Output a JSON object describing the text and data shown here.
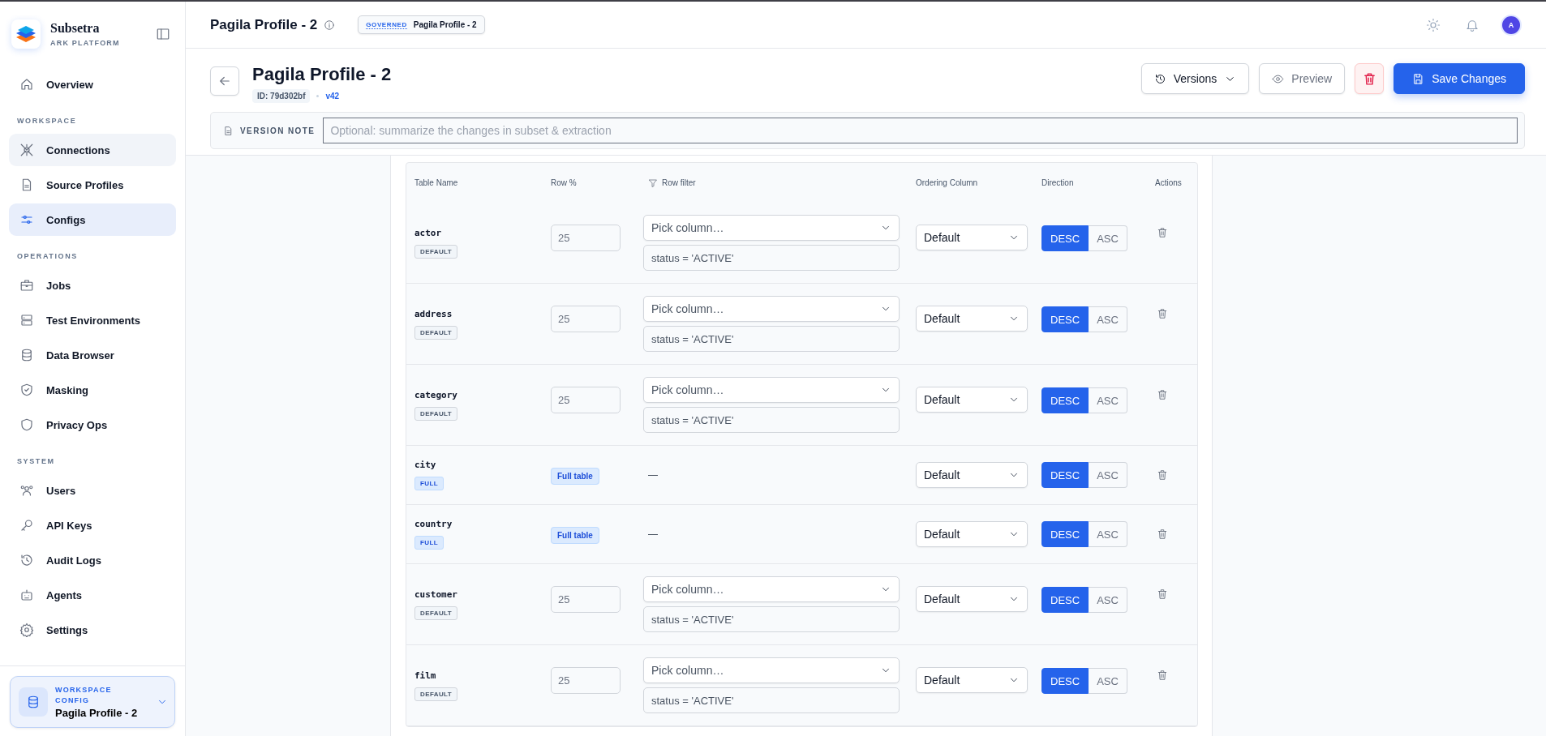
{
  "sidebar": {
    "brand": {
      "name": "Subsetra",
      "subtitle": "ARK PLATFORM"
    },
    "sections": [
      {
        "items": [
          {
            "label": "Overview",
            "kind": "home",
            "selected": false,
            "hovered": false
          }
        ]
      },
      {
        "title": "WORKSPACE",
        "items": [
          {
            "label": "Connections",
            "kind": "plug",
            "selected": false,
            "hovered": true
          },
          {
            "label": "Source Profiles",
            "kind": "file",
            "selected": false,
            "hovered": false
          },
          {
            "label": "Configs",
            "kind": "sliders",
            "selected": true,
            "hovered": false
          }
        ]
      },
      {
        "title": "OPERATIONS",
        "items": [
          {
            "label": "Jobs",
            "kind": "briefcase",
            "selected": false,
            "hovered": false
          },
          {
            "label": "Test Environments",
            "kind": "server",
            "selected": false,
            "hovered": false
          },
          {
            "label": "Data Browser",
            "kind": "database",
            "selected": false,
            "hovered": false
          },
          {
            "label": "Masking",
            "kind": "masking",
            "selected": false,
            "hovered": false
          },
          {
            "label": "Privacy Ops",
            "kind": "shield",
            "selected": false,
            "hovered": false
          }
        ]
      },
      {
        "title": "SYSTEM",
        "items": [
          {
            "label": "Users",
            "kind": "users",
            "selected": false,
            "hovered": false
          },
          {
            "label": "API Keys",
            "kind": "key",
            "selected": false,
            "hovered": false
          },
          {
            "label": "Audit Logs",
            "kind": "history",
            "selected": false,
            "hovered": false
          },
          {
            "label": "Agents",
            "kind": "robot",
            "selected": false,
            "hovered": false
          },
          {
            "label": "Settings",
            "kind": "settings",
            "selected": false,
            "hovered": false
          }
        ]
      }
    ],
    "workspace_card": {
      "label": "WORKSPACE CONFIG",
      "name": "Pagila Profile - 2"
    }
  },
  "topbar": {
    "title": "Pagila Profile - 2",
    "badge": {
      "tag": "GOVERNED",
      "text": "Pagila Profile - 2"
    },
    "avatar": "A"
  },
  "header": {
    "title": "Pagila Profile - 2",
    "id": "ID: 79d302bf",
    "version": "v42",
    "buttons": [
      {
        "kind": "menu",
        "label": "Versions",
        "disabled": false
      },
      {
        "kind": "preview",
        "label": "Preview",
        "disabled": true
      },
      {
        "kind": "delete",
        "disabled": false
      },
      {
        "kind": "primary",
        "label": "Save Changes",
        "disabled": false
      }
    ],
    "version_note": {
      "label": "VERSION NOTE",
      "placeholder": "Optional: summarize the changes in subset & extraction"
    }
  },
  "table": {
    "columns": [
      {
        "label": "Table Name",
        "kind": "plain"
      },
      {
        "label": "Row %",
        "kind": "plain"
      },
      {
        "label": "Row filter",
        "kind": "filter"
      },
      {
        "label": "Ordering Column",
        "kind": "plain"
      },
      {
        "label": "Direction",
        "kind": "plain"
      },
      {
        "label": "Actions",
        "kind": "plain"
      }
    ],
    "rows": [
      {
        "name": "actor",
        "kind": "sampled",
        "mode": "DEFAULT",
        "row_percent": "25",
        "filter_column": "Pick column…",
        "filter_expression": "status = 'ACTIVE'",
        "ordering": "Default",
        "direction": [
          {
            "label": "DESC",
            "selected": true
          },
          {
            "label": "ASC",
            "selected": false
          }
        ]
      },
      {
        "name": "address",
        "kind": "sampled",
        "mode": "DEFAULT",
        "row_percent": "25",
        "filter_column": "Pick column…",
        "filter_expression": "status = 'ACTIVE'",
        "ordering": "Default",
        "direction": [
          {
            "label": "DESC",
            "selected": true
          },
          {
            "label": "ASC",
            "selected": false
          }
        ]
      },
      {
        "name": "category",
        "kind": "sampled",
        "mode": "DEFAULT",
        "row_percent": "25",
        "filter_column": "Pick column…",
        "filter_expression": "status = 'ACTIVE'",
        "ordering": "Default",
        "direction": [
          {
            "label": "DESC",
            "selected": true
          },
          {
            "label": "ASC",
            "selected": false
          }
        ]
      },
      {
        "name": "city",
        "kind": "full",
        "mode": "FULL",
        "row_percent": "Full table",
        "filter": "—",
        "ordering": "Default",
        "direction": [
          {
            "label": "DESC",
            "selected": true
          },
          {
            "label": "ASC",
            "selected": false
          }
        ]
      },
      {
        "name": "country",
        "kind": "full",
        "mode": "FULL",
        "row_percent": "Full table",
        "filter": "—",
        "ordering": "Default",
        "direction": [
          {
            "label": "DESC",
            "selected": true
          },
          {
            "label": "ASC",
            "selected": false
          }
        ]
      },
      {
        "name": "customer",
        "kind": "sampled",
        "mode": "DEFAULT",
        "row_percent": "25",
        "filter_column": "Pick column…",
        "filter_expression": "status = 'ACTIVE'",
        "ordering": "Default",
        "direction": [
          {
            "label": "DESC",
            "selected": true
          },
          {
            "label": "ASC",
            "selected": false
          }
        ]
      },
      {
        "name": "film",
        "kind": "sampled",
        "mode": "DEFAULT",
        "row_percent": "25",
        "filter_column": "Pick column…",
        "filter_expression": "status = 'ACTIVE'",
        "ordering": "Default",
        "direction": [
          {
            "label": "DESC",
            "selected": true
          },
          {
            "label": "ASC",
            "selected": false
          }
        ]
      }
    ]
  }
}
